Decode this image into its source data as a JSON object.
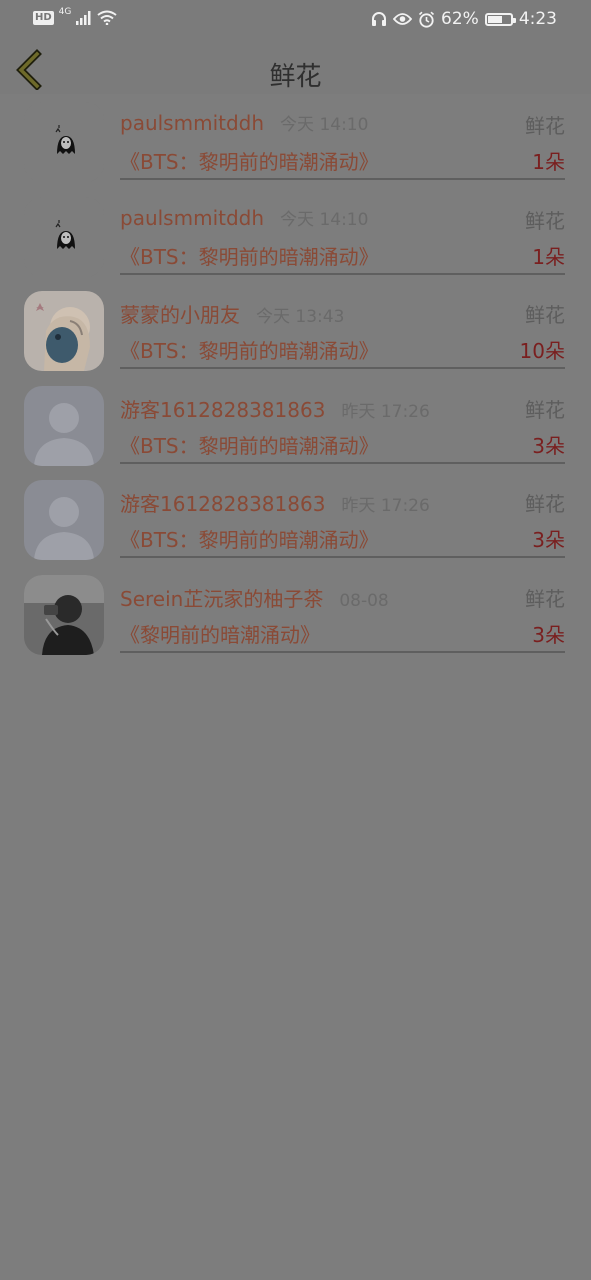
{
  "status_bar": {
    "hd": "HD",
    "network": "4G",
    "battery_percent": "62%",
    "battery_level": 0.62,
    "time": "4:23"
  },
  "header": {
    "title": "鲜花",
    "back_icon": "chevron-left-icon",
    "accent": "#6e6a2a"
  },
  "records": [
    {
      "username": "paulsmmitddh",
      "time": "今天 14:10",
      "type": "鲜花",
      "title": "《BTS：黎明前的暗潮涌动》",
      "count": "1朵",
      "avatar": "ghost-sticker"
    },
    {
      "username": "paulsmmitddh",
      "time": "今天 14:10",
      "type": "鲜花",
      "title": "《BTS：黎明前的暗潮涌动》",
      "count": "1朵",
      "avatar": "ghost-sticker"
    },
    {
      "username": "蒙蒙的小朋友",
      "time": "今天 13:43",
      "type": "鲜花",
      "title": "《BTS：黎明前的暗潮涌动》",
      "count": "10朵",
      "avatar": "anime-girl"
    },
    {
      "username": "游客1612828381863",
      "time": "昨天 17:26",
      "type": "鲜花",
      "title": "《BTS：黎明前的暗潮涌动》",
      "count": "3朵",
      "avatar": "default-person"
    },
    {
      "username": "游客1612828381863",
      "time": "昨天 17:26",
      "type": "鲜花",
      "title": "《BTS：黎明前的暗潮涌动》",
      "count": "3朵",
      "avatar": "default-person"
    },
    {
      "username": "Serein芷沅家的柚子茶",
      "time": "08-08",
      "type": "鲜花",
      "title": "《黎明前的暗潮涌动》",
      "count": "3朵",
      "avatar": "photo-person"
    }
  ],
  "colors": {
    "overlay_bg": "#7d7d7d",
    "username": "#8a4a36",
    "count": "#7a1f1f"
  }
}
